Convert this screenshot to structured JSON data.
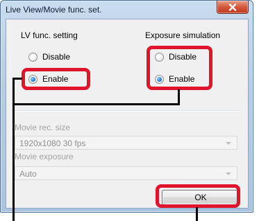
{
  "window": {
    "title": "Live View/Movie func. set."
  },
  "lv_func": {
    "heading": "LV func. setting",
    "options": [
      {
        "label": "Disable",
        "checked": false
      },
      {
        "label": "Enable",
        "checked": true
      }
    ]
  },
  "exposure_sim": {
    "heading": "Exposure simulation",
    "options": [
      {
        "label": "Disable",
        "checked": false
      },
      {
        "label": "Enable",
        "checked": true
      }
    ]
  },
  "movie_rec_size": {
    "label": "Movie rec. size",
    "value": "1920x1080  30 fps",
    "enabled": false
  },
  "movie_exposure": {
    "label": "Movie exposure",
    "value": "Auto",
    "enabled": false
  },
  "ok_button": {
    "label": "OK"
  },
  "annotation_color": "#e0142c"
}
